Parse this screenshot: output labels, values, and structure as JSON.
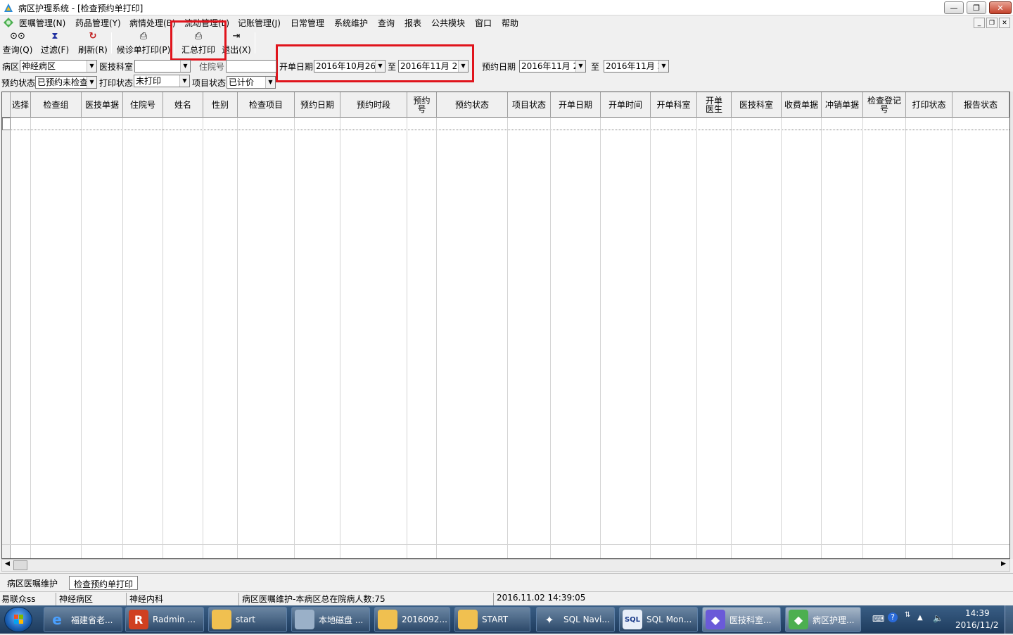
{
  "window": {
    "title": "病区护理系统 - [检查预约单打印]",
    "minimize": "—",
    "restore": "❐",
    "close": "✕",
    "mdi_min": "_",
    "mdi_restore": "❐",
    "mdi_close": "✕"
  },
  "menu": {
    "items": [
      "医嘱管理(N)",
      "药品管理(Y)",
      "病情处理(B)",
      "流动管理(L)",
      "记账管理(J)",
      "日常管理",
      "系统维护",
      "查询",
      "报表",
      "公共模块",
      "窗口",
      "帮助"
    ]
  },
  "toolbar": {
    "buttons": [
      {
        "label": "查询(Q)",
        "icon": "binoculars-icon",
        "glyph": "⊙⊙"
      },
      {
        "label": "过滤(F)",
        "icon": "hourglass-icon",
        "glyph": "⧗"
      },
      {
        "label": "刷新(R)",
        "icon": "refresh-icon",
        "glyph": "↻"
      },
      {
        "label": "候诊单打印(P)",
        "icon": "printer-icon",
        "glyph": "⎙"
      },
      {
        "label": "汇总打印",
        "icon": "printer-icon",
        "glyph": "⎙"
      },
      {
        "label": "退出(X)",
        "icon": "exit-icon",
        "glyph": "⇥"
      }
    ]
  },
  "filters": {
    "ward_label": "病区",
    "ward_value": "神经病区",
    "dept_label": "医技科室",
    "dept_value": "",
    "inpatient_label": "住院号",
    "order_date_label": "开单日期",
    "order_date_from": "2016年10月26日",
    "to1": "至",
    "order_date_to": "2016年11月 2日",
    "appt_date_label": "预约日期",
    "appt_date_from": "2016年11月 2",
    "to2": "至",
    "appt_date_to": "2016年11月 2",
    "appt_status_label": "预约状态",
    "appt_status_value": "已预约未检查",
    "print_status_label": "打印状态",
    "print_status_value": "未打印",
    "item_status_label": "项目状态",
    "item_status_value": "已计价"
  },
  "grid": {
    "columns": [
      "选择",
      "检查组",
      "医技单据",
      "住院号",
      "姓名",
      "性别",
      "检查项目",
      "预约日期",
      "预约时段",
      "预约号",
      "预约状态",
      "项目状态",
      "开单日期",
      "开单时间",
      "开单科室",
      "开单医生",
      "医技科室",
      "收费单据",
      "冲销单据",
      "检查登记号",
      "打印状态",
      "报告状态"
    ]
  },
  "tabs": [
    "病区医嘱维护",
    "检查预约单打印"
  ],
  "status": {
    "user": "易联众ss",
    "ward": "神经病区",
    "dept": "神经内科",
    "message": "病区医嘱维护-本病区总在院病人数:75",
    "datetime": "2016.11.02 14:39:05"
  },
  "taskbar": {
    "tasks": [
      {
        "label": "福建省老...",
        "icon": "ie-icon"
      },
      {
        "label": "Radmin ...",
        "icon": "radmin-icon"
      },
      {
        "label": "start",
        "icon": "folder-icon"
      },
      {
        "label": "本地磁盘 ...",
        "icon": "drive-icon"
      },
      {
        "label": "2016092...",
        "icon": "folder-icon"
      },
      {
        "label": "START",
        "icon": "folder-icon"
      },
      {
        "label": "SQL Navi...",
        "icon": "compass-icon"
      },
      {
        "label": "SQL Mon...",
        "icon": "sql-monitor-icon"
      },
      {
        "label": "医技科室...",
        "icon": "app-icon"
      },
      {
        "label": "病区护理...",
        "icon": "app-icon"
      }
    ],
    "time": "14:39",
    "date": "2016/11/2"
  },
  "colors": {
    "highlight_box": "#e0141c",
    "taskbar": "#2a4a6e"
  }
}
